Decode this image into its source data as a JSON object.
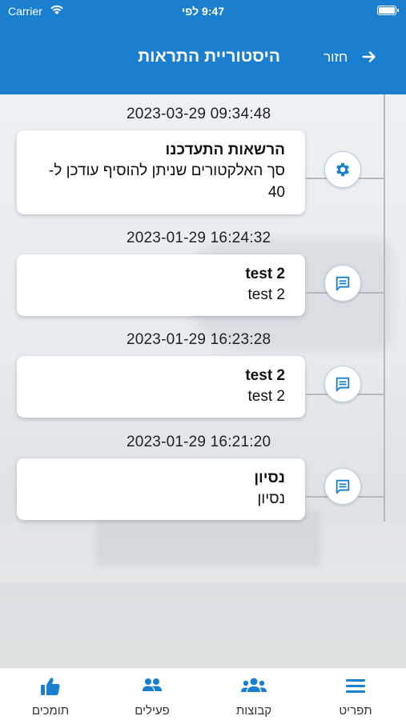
{
  "status_bar": {
    "carrier": "Carrier",
    "time": "9:47 לפי"
  },
  "header": {
    "title": "היסטוריית התראות",
    "back_label": "חזור"
  },
  "notifications": [
    {
      "timestamp": "2023-03-29 09:34:48",
      "title": "הרשאות התעדכנו",
      "body_line1": "סך האלקטורים שניתן להוסיף עודכן ל-",
      "body_line2": "40",
      "icon": "gear-icon"
    },
    {
      "timestamp": "2023-01-29 16:24:32",
      "title": "test 2",
      "body_line1": "test 2",
      "icon": "message-icon"
    },
    {
      "timestamp": "2023-01-29 16:23:28",
      "title": "test 2",
      "body_line1": "test 2",
      "icon": "message-icon"
    },
    {
      "timestamp": "2023-01-29 16:21:20",
      "title": "נסיון",
      "body_line1": "נסיון",
      "icon": "message-icon"
    }
  ],
  "tabbar": {
    "items": [
      {
        "label": "תפריט",
        "icon": "menu-icon"
      },
      {
        "label": "קבוצות",
        "icon": "groups-icon"
      },
      {
        "label": "פעילים",
        "icon": "activists-icon"
      },
      {
        "label": "תומכים",
        "icon": "thumbs-up-icon"
      }
    ]
  },
  "colors": {
    "accent": "#1a7fcf",
    "icon_blue": "#1a7fcf"
  }
}
